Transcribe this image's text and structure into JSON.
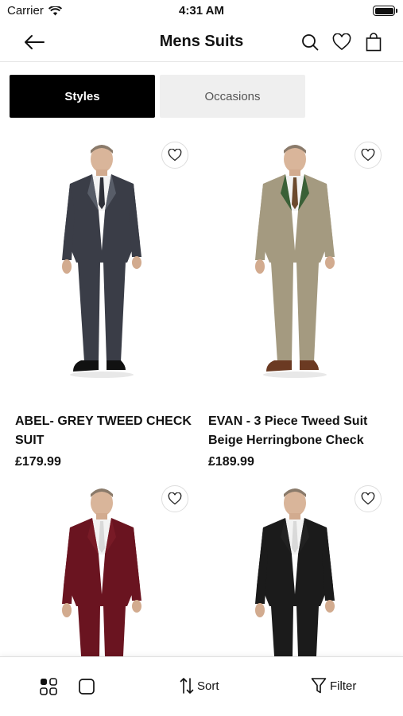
{
  "status_bar": {
    "carrier": "Carrier",
    "time": "4:31 AM"
  },
  "nav": {
    "title": "Mens Suits"
  },
  "tabs": [
    {
      "label": "Styles",
      "active": true
    },
    {
      "label": "Occasions",
      "active": false
    }
  ],
  "products": [
    {
      "name": "ABEL- GREY TWEED CHECK SUIT",
      "price": "£179.99",
      "color": "#3a3d47",
      "accent": "#5c606b",
      "tie": "#2e3038",
      "shoes": "#111111"
    },
    {
      "name": "EVAN - 3 Piece Tweed Suit Beige Herringbone Check",
      "price": "£189.99",
      "color": "#a49a80",
      "accent": "#2f5a2f",
      "tie": "#6b4a2d",
      "shoes": "#6b3a22"
    },
    {
      "name": "",
      "price": "",
      "color": "#6a1420",
      "accent": "#7a1b27",
      "tie": "#d9d9d9",
      "shoes": "#111111"
    },
    {
      "name": "",
      "price": "",
      "color": "#1b1b1b",
      "accent": "#222222",
      "tie": "#d9d9d9",
      "shoes": "#111111"
    }
  ],
  "bottom_bar": {
    "sort_label": "Sort",
    "filter_label": "Filter"
  },
  "icons": {
    "back": "arrow-left-icon",
    "search": "search-icon",
    "wishlist": "heart-icon",
    "bag": "shopping-bag-icon",
    "grid": "grid-view-icon",
    "single": "single-view-icon",
    "sort": "sort-icon",
    "filter": "filter-icon"
  }
}
